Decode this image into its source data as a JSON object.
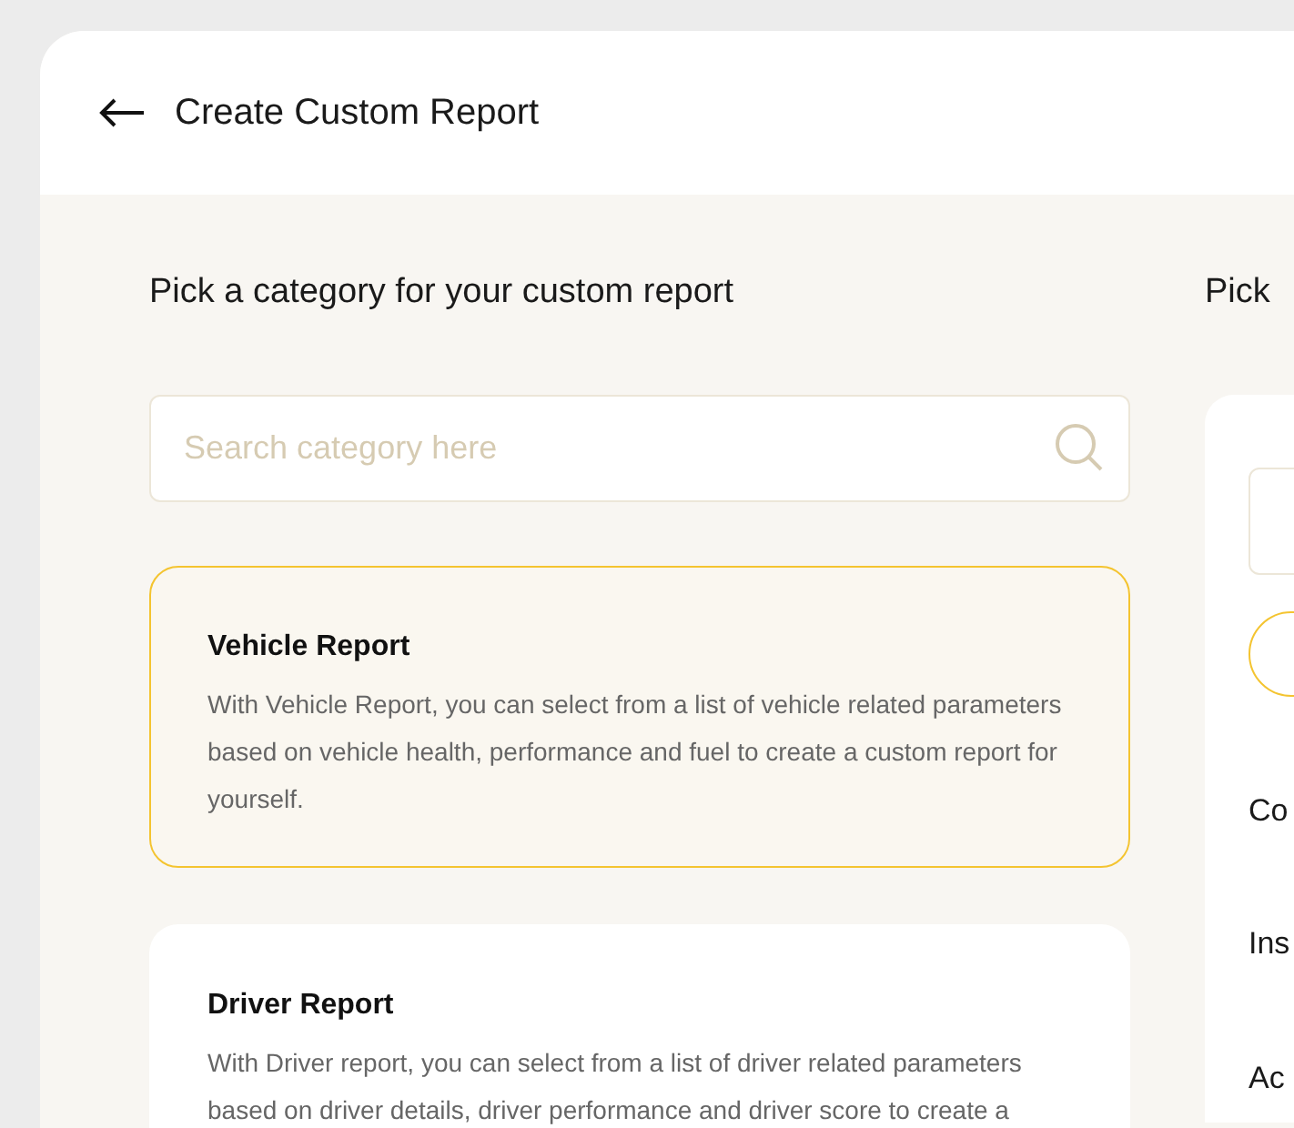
{
  "header": {
    "title": "Create Custom Report"
  },
  "category_panel": {
    "heading": "Pick a category for your custom report",
    "search": {
      "placeholder": "Search category here"
    },
    "categories": [
      {
        "title": "Vehicle Report",
        "description": "With Vehicle Report, you can select from a list of vehicle related parameters based on vehicle health, performance and fuel to create a custom report for yourself.",
        "selected": true
      },
      {
        "title": "Driver Report",
        "description": "With Driver report, you can select from a list of driver related parameters based on driver details, driver performance and driver score to create a",
        "selected": false
      }
    ]
  },
  "parameter_panel": {
    "heading": "Pick",
    "items": [
      "Co",
      "Ins",
      "Ac"
    ]
  }
}
